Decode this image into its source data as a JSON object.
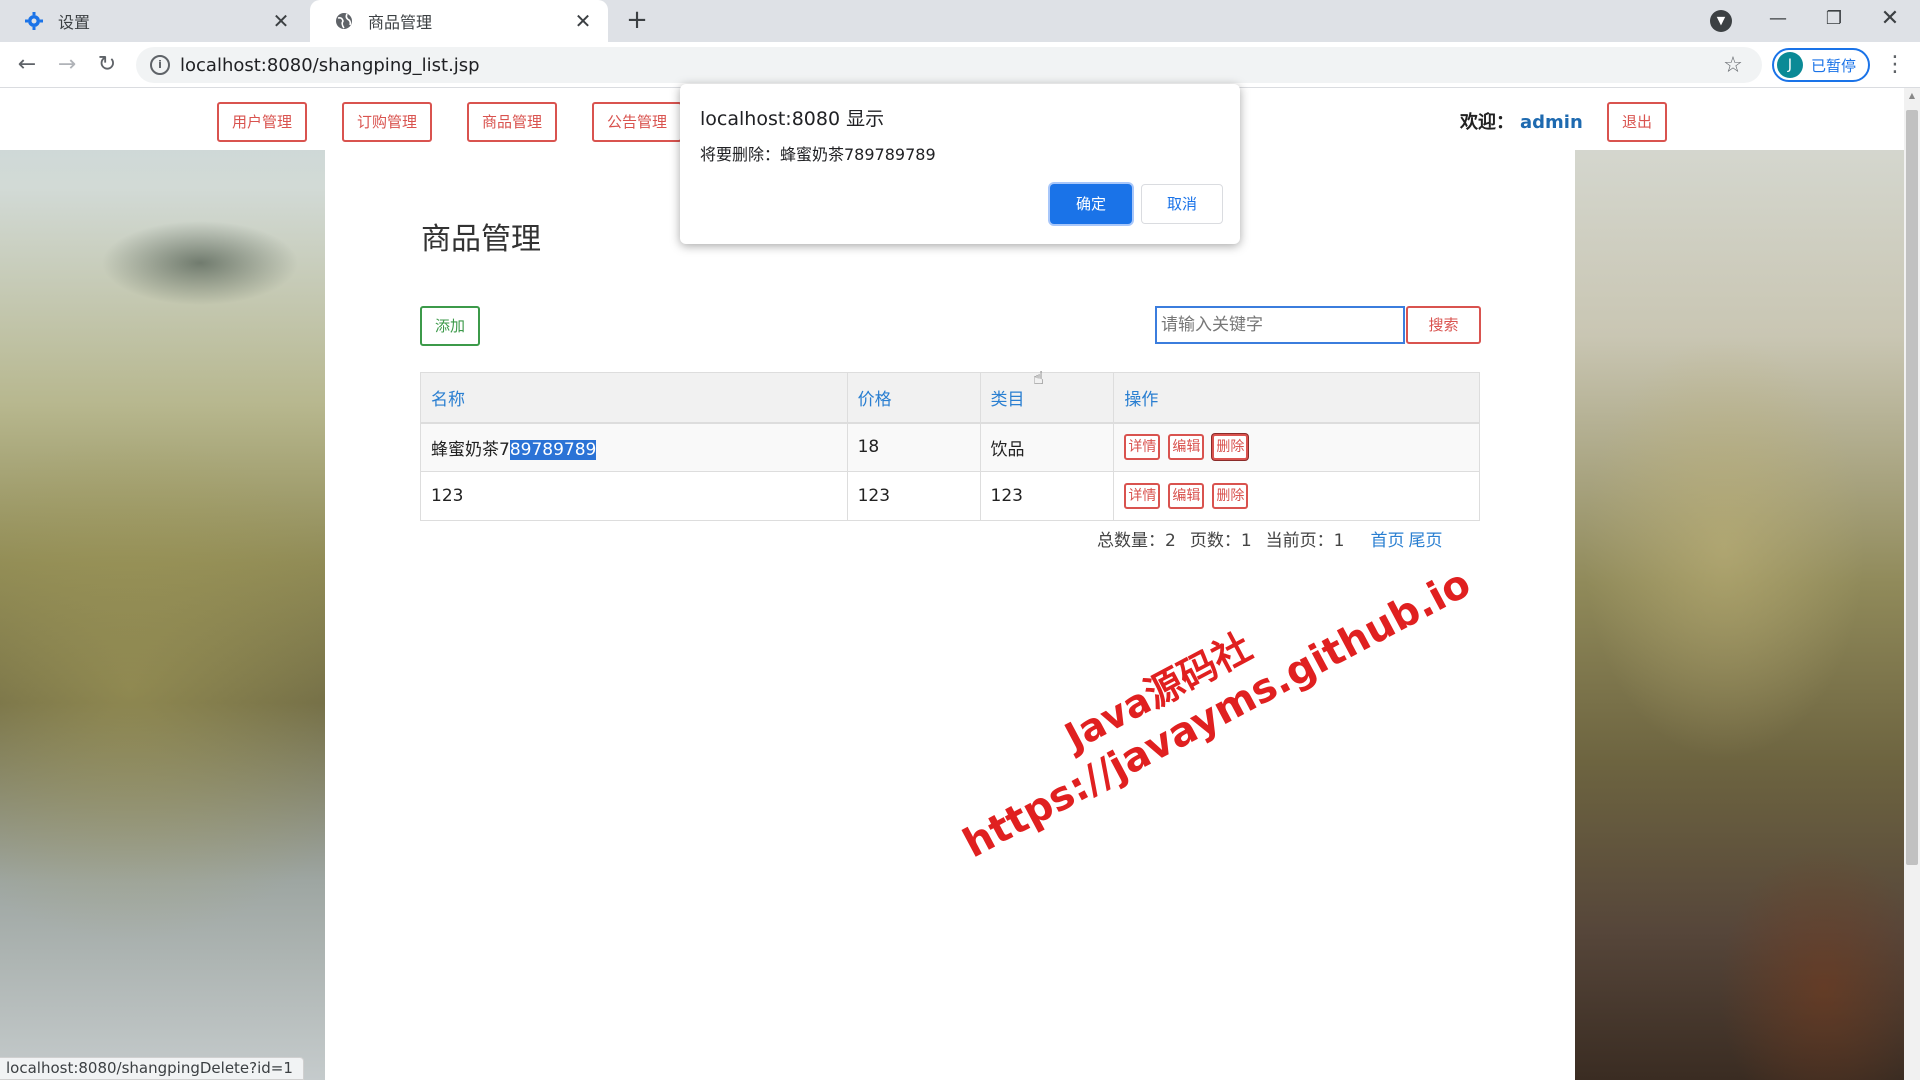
{
  "browser": {
    "tabs": [
      {
        "title": "设置",
        "icon": "gear-icon"
      },
      {
        "title": "商品管理",
        "icon": "globe-icon"
      }
    ],
    "url": "localhost:8080/shangping_list.jsp",
    "profile_initial": "J",
    "profile_status": "已暂停",
    "status_url": "localhost:8080/shangpingDelete?id=1"
  },
  "nav": {
    "items": [
      "用户管理",
      "订购管理",
      "商品管理",
      "公告管理"
    ],
    "welcome_label": "欢迎：",
    "username": "admin",
    "logout": "退出"
  },
  "page": {
    "title": "商品管理",
    "add_label": "添加",
    "search_placeholder": "请输入关键字",
    "search_label": "搜索"
  },
  "table": {
    "headers": [
      "名称",
      "价格",
      "类目",
      "操作"
    ],
    "rows": [
      {
        "name_prefix": "蜂蜜奶茶7",
        "name_selected": "89789789",
        "price": "18",
        "category": "饮品"
      },
      {
        "name_prefix": "123",
        "name_selected": "",
        "price": "123",
        "category": "123"
      }
    ],
    "actions": [
      "详情",
      "编辑",
      "删除"
    ]
  },
  "pagination": {
    "total": "总数量：2",
    "pages": "页数：1",
    "current": "当前页：1",
    "first": "首页",
    "last": "尾页"
  },
  "dialog": {
    "title": "localhost:8080 显示",
    "message": "将要删除：蜂蜜奶茶789789789",
    "ok": "确定",
    "cancel": "取消"
  },
  "watermark": {
    "line1": "Java源码社",
    "line2": "https://javayms.github.io"
  },
  "colors": {
    "accent_red": "#d9534f",
    "accent_green": "#3c9a4a",
    "link_blue": "#2a7fd1",
    "dialog_blue": "#1a73e8"
  }
}
